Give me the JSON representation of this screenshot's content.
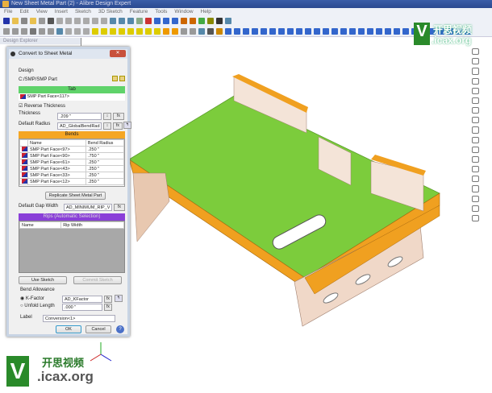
{
  "window": {
    "title": "New Sheet Metal Part (2) - Alibre Design Expert"
  },
  "menu": [
    "File",
    "Edit",
    "View",
    "Insert",
    "Sketch",
    "3D Sketch",
    "Feature",
    "Tools",
    "Window",
    "Help"
  ],
  "explorer": {
    "title": "Design Explorer"
  },
  "dialog": {
    "title": "Convert to Sheet Metal",
    "close": "✕",
    "design_label": "Design",
    "design_value": "C:/SMP/SMP Part",
    "tab_header": "Tab",
    "tab_face": "SMP Part Face<117>",
    "reverse_thickness": "Reverse Thickness",
    "reverse_checked": true,
    "thickness_label": "Thickness",
    "thickness_value": ".209 \"",
    "radius_label": "Default Radius",
    "radius_value": "AD_GlobalBendRad",
    "fx": "fx",
    "bends_header": "Bends",
    "bends_cols": [
      "Name",
      "Bend Radius"
    ],
    "bends": [
      [
        "SMP Part Face<97>",
        ".250 \""
      ],
      [
        "SMP Part Face<90>",
        ".750 \""
      ],
      [
        "SMP Part Face<61>",
        ".250 \""
      ],
      [
        "SMP Part Face<43>",
        ".250 \""
      ],
      [
        "SMP Part Face<33>",
        ".250 \""
      ],
      [
        "SMP Part Face<12>",
        ".250 \""
      ]
    ],
    "replicate_button": "Replicate Sheet Metal Part",
    "gap_label": "Default Gap Width",
    "gap_value": "AD_MINIMUM_RIP_V",
    "rips_header": "Rips (Automatic Selection)",
    "rips_cols": [
      "Name",
      "Rip Width"
    ],
    "use_sketch": "Use Sketch",
    "commit_sketch": "Commit Sketch",
    "bend_allowance": "Bend Allowance",
    "kfactor_label": "K-Factor",
    "kfactor_value": "AD_KFactor",
    "unfold_label": "Unfold Length",
    "unfold_value": ".000 \"",
    "label_label": "Label",
    "label_value": "Conversion<1>",
    "ok": "OK",
    "cancel": "Cancel",
    "help": "?"
  },
  "watermark": {
    "cn": "开思视频",
    "site": ".icax.org",
    "v": "V"
  },
  "colors": {
    "plate": "#7ccc3c",
    "edge": "#f0a020",
    "accent": "#5fd36a"
  }
}
